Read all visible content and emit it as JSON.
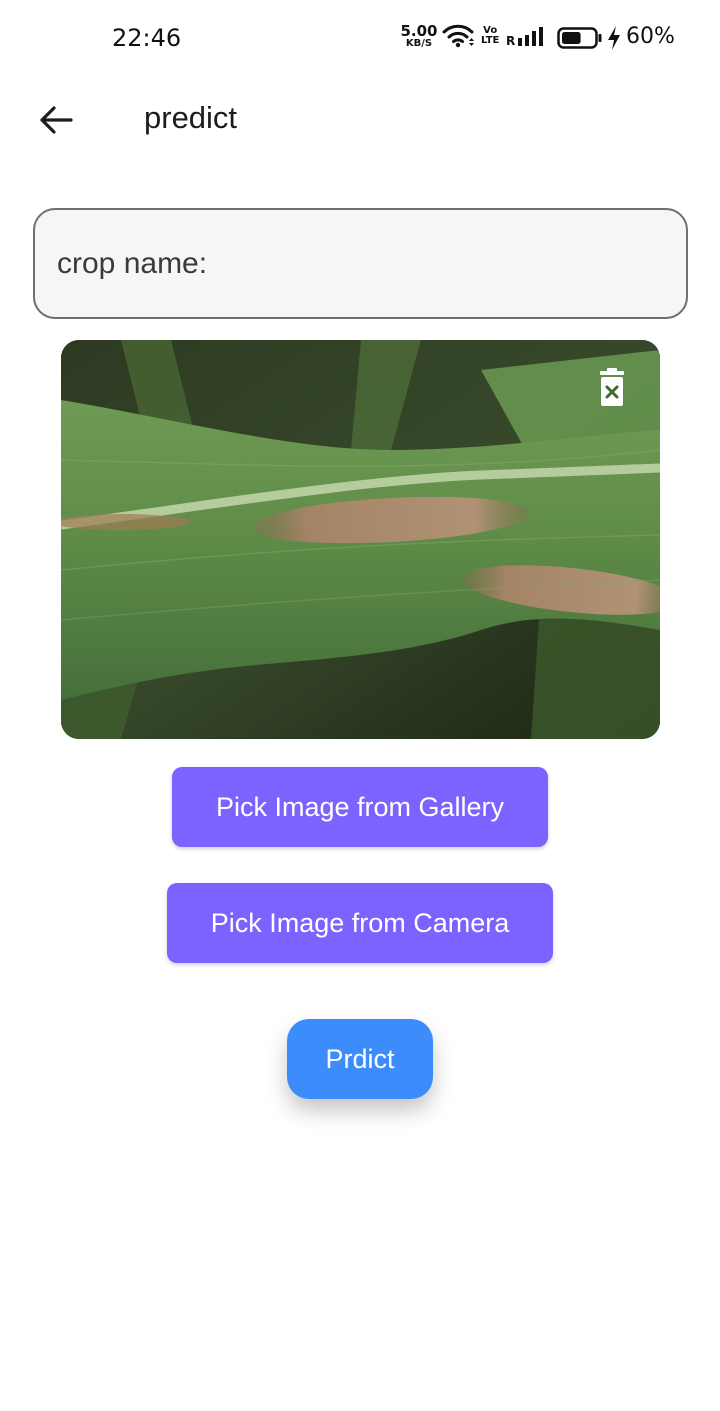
{
  "status_bar": {
    "time": "22:46",
    "net_speed_value": "5.00",
    "net_speed_unit": "KB/S",
    "volte_top": "Vo",
    "volte_bottom": "LTE",
    "roaming": "R",
    "battery_percent": "60%",
    "battery_level": 0.6,
    "charging": true
  },
  "app_bar": {
    "back_icon": "arrow-left-icon",
    "title": "predict"
  },
  "form": {
    "crop_name_placeholder": "crop name:",
    "crop_name_value": ""
  },
  "preview": {
    "image_subject": "diseased maize leaf with brown lesions",
    "delete_icon": "trash-icon"
  },
  "actions": {
    "gallery_label": "Pick Image from Gallery",
    "camera_label": "Pick Image from Camera",
    "predict_label": "Prdict"
  },
  "colors": {
    "pick_button": "#7b63ff",
    "predict_button": "#3d8cfb",
    "field_border": "#6f6f6f",
    "field_background": "#f6f6f6"
  }
}
